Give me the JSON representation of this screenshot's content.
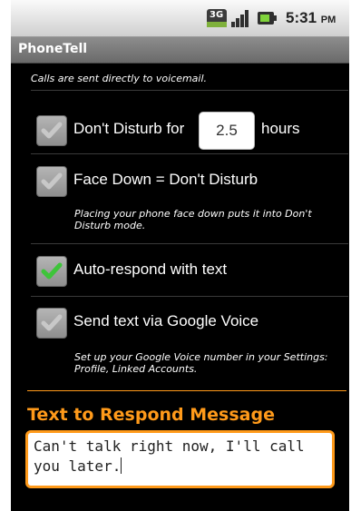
{
  "status_bar": {
    "network_icon": "3g-data-icon",
    "signal_icon": "signal-strength-icon",
    "battery_icon": "battery-icon",
    "time": "5:31",
    "ampm": "PM"
  },
  "app": {
    "title": "PhoneTell"
  },
  "header_note": "Calls are sent directly to voicemail.",
  "settings": {
    "dont_disturb": {
      "label": "Don't Disturb for",
      "checked": false,
      "hours_value": "2.5",
      "hours_suffix": "hours"
    },
    "face_down": {
      "label": "Face Down = Don't Disturb",
      "checked": false,
      "description": "Placing your phone face down puts it into Don't Disturb mode."
    },
    "auto_respond": {
      "label": "Auto-respond with text",
      "checked": true
    },
    "google_voice": {
      "label": "Send text via Google Voice",
      "checked": false,
      "description": "Set up your Google Voice number in your Settings: Profile, Linked Accounts."
    }
  },
  "message_section": {
    "header": "Text to Respond Message",
    "message": "Can't talk right now, I'll call you later."
  },
  "colors": {
    "accent": "#ff9a1a",
    "check_green": "#3ec43a",
    "check_gray": "#c8c8c8"
  }
}
